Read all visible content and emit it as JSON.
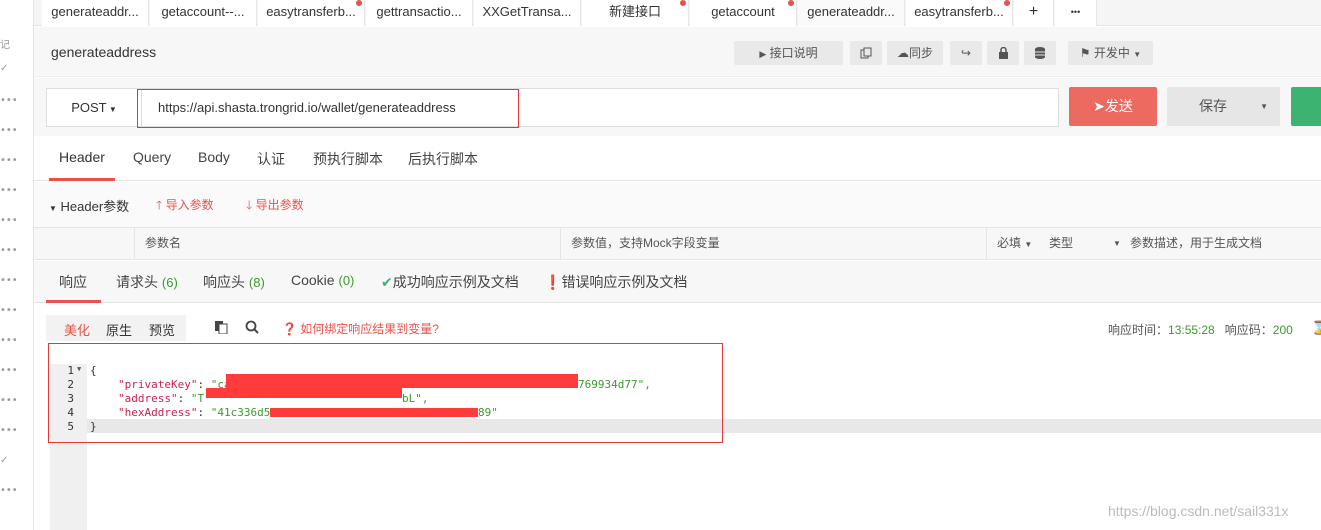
{
  "tabs": [
    {
      "label": "generateaddr...",
      "dot": false
    },
    {
      "label": "getaccount--...",
      "dot": false
    },
    {
      "label": "easytransferb...",
      "dot": true
    },
    {
      "label": "gettransactio...",
      "dot": false
    },
    {
      "label": "XXGetTransa...",
      "dot": false
    },
    {
      "label": "新建接口",
      "dot": true
    },
    {
      "label": "getaccount",
      "dot": true
    },
    {
      "label": "generateaddr...",
      "dot": false
    },
    {
      "label": "easytransferb...",
      "dot": true
    }
  ],
  "tab_add": "+",
  "tab_more": "•••",
  "page_title": "generateaddress",
  "title_actions": {
    "doc": "接口说明",
    "sync": "同步",
    "status": "开发中"
  },
  "request": {
    "method": "POST",
    "url": "https://api.shasta.trongrid.io/wallet/generateaddress",
    "send": "发送",
    "save": "保存"
  },
  "sub_tabs": [
    "Header",
    "Query",
    "Body",
    "认证",
    "预执行脚本",
    "后执行脚本"
  ],
  "header_section": {
    "title": "Header参数",
    "import": "导入参数",
    "export": "导出参数"
  },
  "table_headers": {
    "name": "参数名",
    "value": "参数值，支持Mock字段变量",
    "required": "必填",
    "type": "类型",
    "desc": "参数描述，用于生成文档"
  },
  "response_tabs": {
    "response": "响应",
    "req_headers": "请求头",
    "req_headers_count": "(6)",
    "resp_headers": "响应头",
    "resp_headers_count": "(8)",
    "cookie": "Cookie",
    "cookie_count": "(0)",
    "success_doc": "成功响应示例及文档",
    "error_doc": "错误响应示例及文档"
  },
  "view_modes": [
    "美化",
    "原生",
    "预览"
  ],
  "bind_hint": "如何绑定响应结果到变量?",
  "response_time_label": "响应时间：",
  "response_time": "13:55:28",
  "response_code_label": "响应码：",
  "response_code": "200",
  "code_lines": {
    "l1": "{",
    "l2_key": "\"privateKey\"",
    "l2_val_start": "\"ca",
    "l2_val_end": "769934d77\",",
    "l3_key": "\"address\"",
    "l3_val_start": "\"T",
    "l3_val_end": "bL\",",
    "l4_key": "\"hexAddress\"",
    "l4_val_start": "\"41c336d5",
    "l4_val_end": "89\"",
    "l5": "}"
  },
  "line_numbers": [
    "1",
    "2",
    "3",
    "4",
    "5"
  ],
  "watermark": "https://blog.csdn.net/sail331x",
  "colors": {
    "send": "#ec6a60",
    "accent_red": "#e9524a",
    "string": "#3c9a2e",
    "key": "#c7254e"
  }
}
